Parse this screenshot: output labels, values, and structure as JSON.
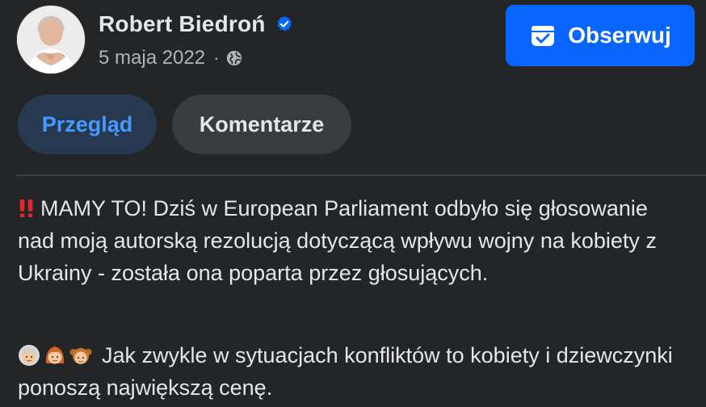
{
  "author": {
    "name": "Robert Biedroń",
    "verified_icon": "verified-badge-icon",
    "avatar_icon": "profile-photo"
  },
  "meta": {
    "date": "5 maja 2022",
    "separator": "·",
    "audience_icon": "globe-icon"
  },
  "follow_button": {
    "label": "Obserwuj",
    "icon": "follow-icon",
    "color": "#0866ff"
  },
  "tabs": [
    {
      "label": "Przegląd",
      "active": true
    },
    {
      "label": "Komentarze",
      "active": false
    }
  ],
  "post": {
    "paragraph1_icon": "double-exclamation-icon",
    "paragraph1": "MAMY TO! Dziś w European Parliament odbyło się głosowanie nad moją autorską rezolucją dotyczącą wpływu wojny na kobiety z Ukrainy - została ona poparta przez głosujących.",
    "paragraph2_emojis": [
      "older-woman-emoji",
      "woman-emoji",
      "girl-emoji"
    ],
    "paragraph2": "Jak zwykle w sytuacjach konfliktów to kobiety i dziewczynki ponoszą największą cenę."
  },
  "colors": {
    "background": "#242526",
    "active_tab_bg": "#263951",
    "active_tab_text": "#4599ff",
    "inactive_tab_bg": "#3a3b3c",
    "secondary_text": "#b0b3b8"
  }
}
